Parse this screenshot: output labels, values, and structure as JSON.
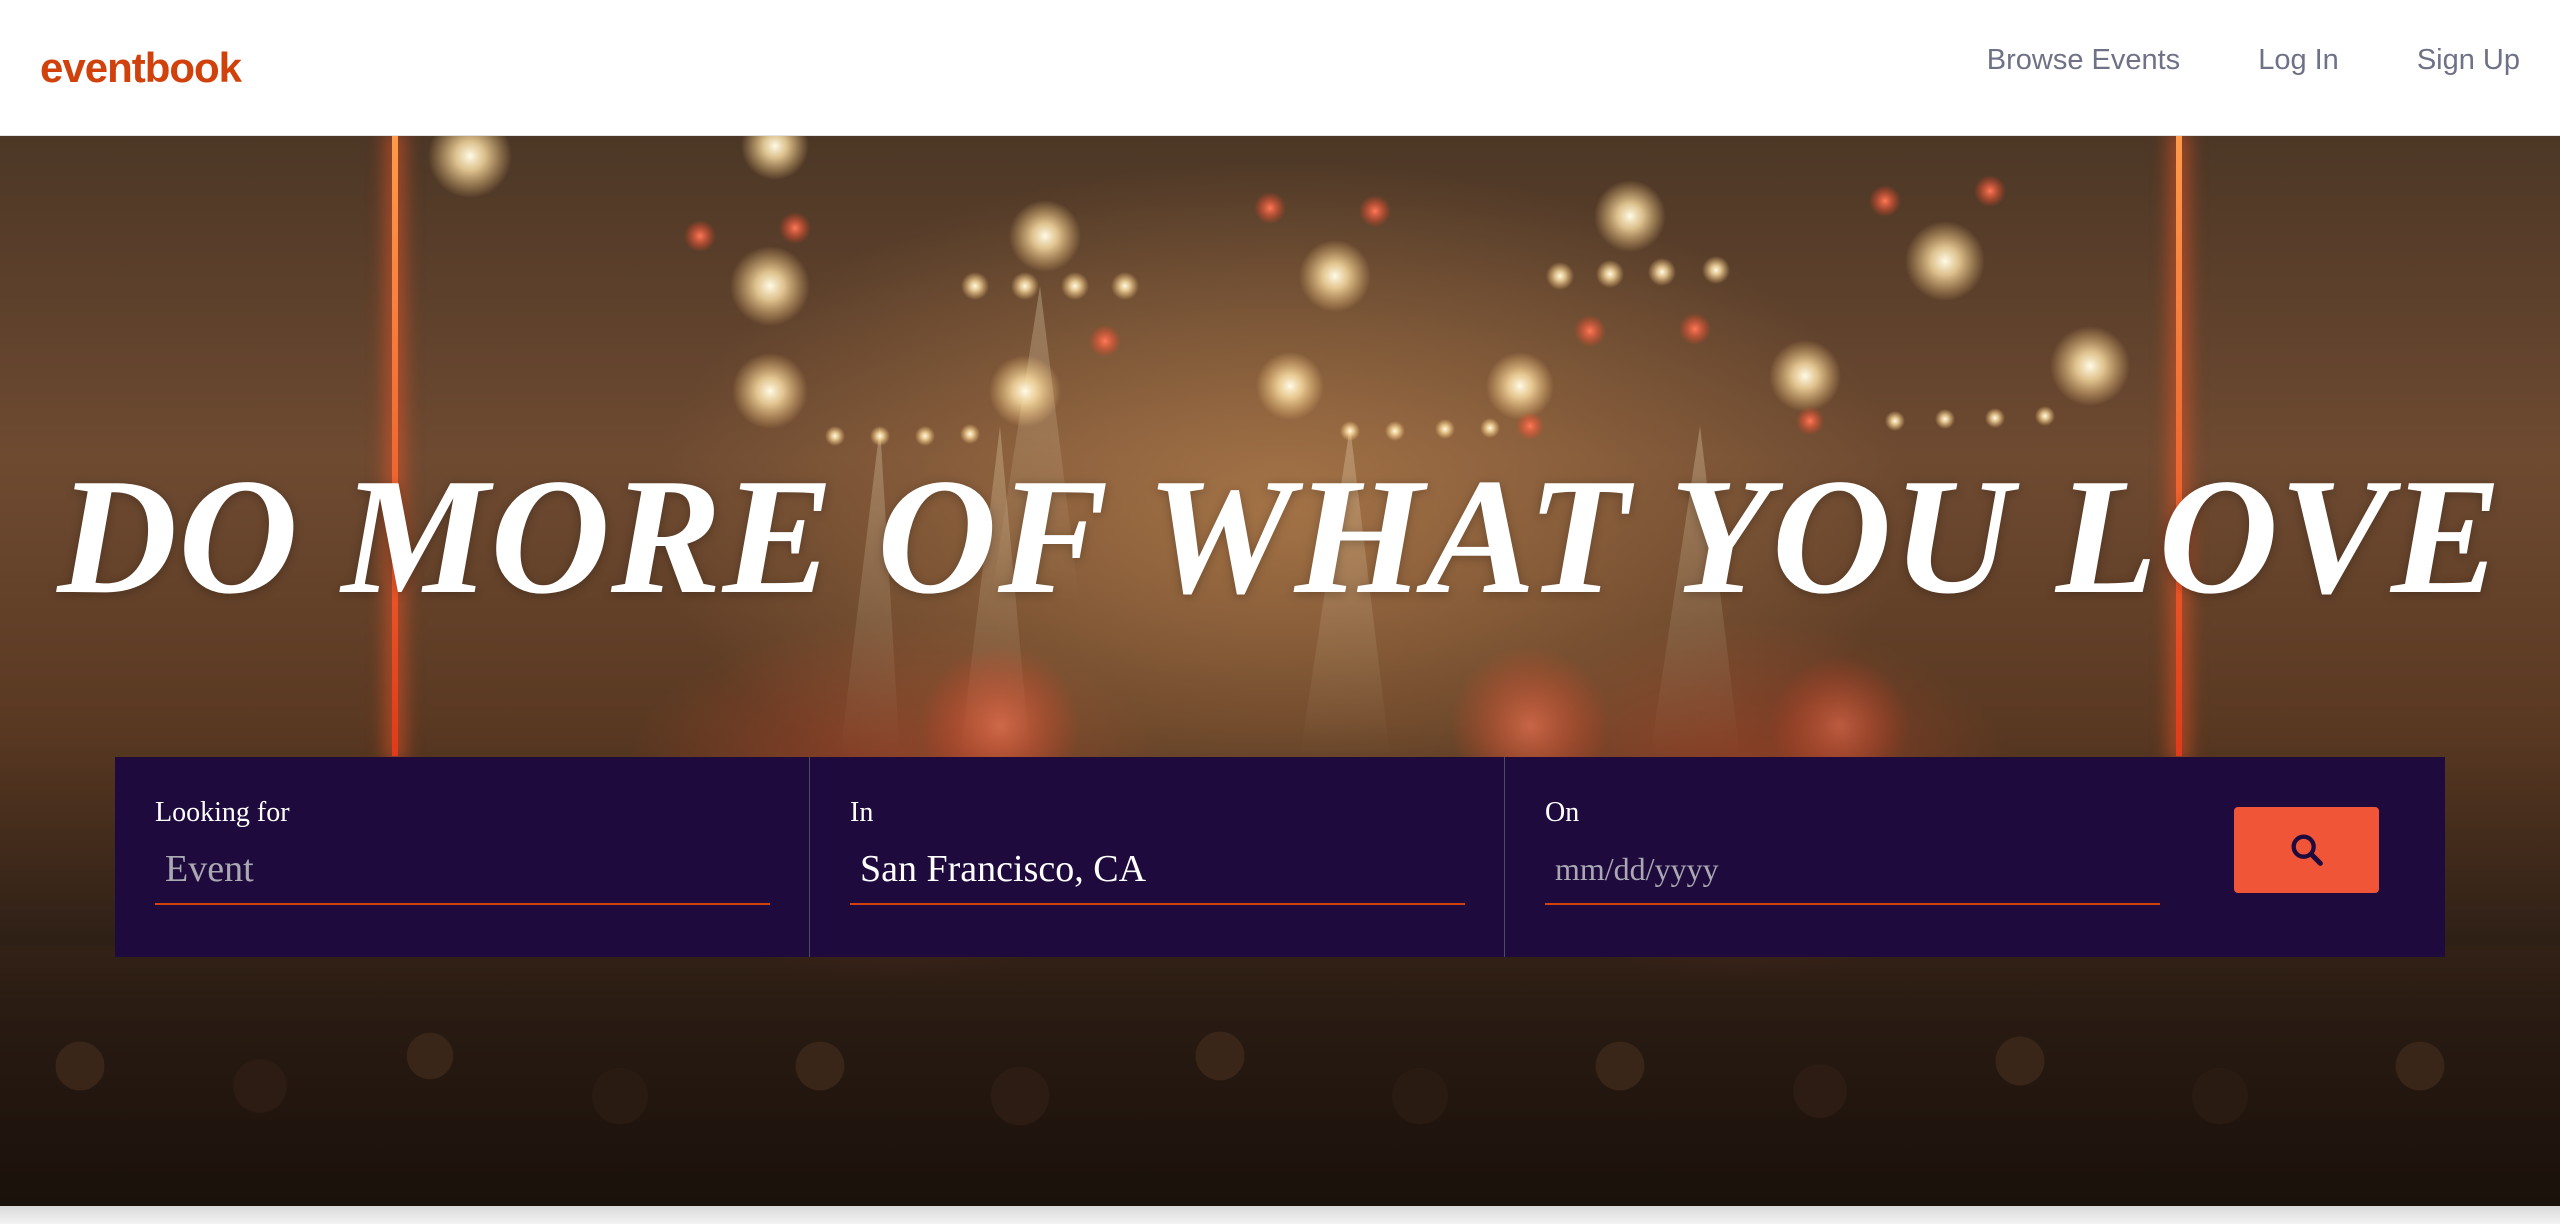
{
  "header": {
    "logo": "eventbook",
    "nav": {
      "browse": "Browse Events",
      "login": "Log In",
      "signup": "Sign Up"
    }
  },
  "hero": {
    "title": "DO MORE OF WHAT YOU LOVE"
  },
  "search": {
    "looking_for": {
      "label": "Looking for",
      "placeholder": "Event",
      "value": ""
    },
    "location": {
      "label": "In",
      "value": "San Francisco, CA"
    },
    "date": {
      "label": "On",
      "placeholder": "mm/dd/yyyy"
    },
    "button_icon": "search-icon"
  },
  "colors": {
    "brand": "#d1410c",
    "search_bar_bg": "#1e0a3c",
    "search_button": "#f05537",
    "nav_text": "#6f7287"
  }
}
